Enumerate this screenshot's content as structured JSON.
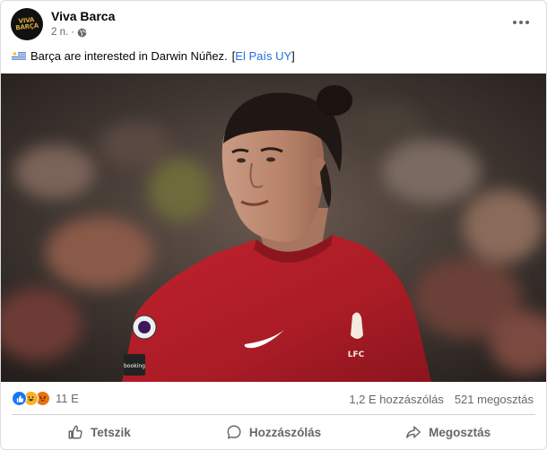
{
  "post": {
    "author": "Viva Barca",
    "avatar_text_top": "VIVA",
    "avatar_text_bottom": "BARÇA",
    "time": "2 n.",
    "text": "Barça are interested in Darwin Núñez.",
    "link_open": "[",
    "link_text": "El País UY",
    "link_close": "]",
    "flag_icon": "uruguay-flag-icon"
  },
  "image": {
    "jersey_sponsor": "LFC",
    "sleeve_text": "booking"
  },
  "stats": {
    "reactions_count": "11 E",
    "comments": "1,2 E hozzászólás",
    "shares": "521 megosztás"
  },
  "actions": {
    "like": "Tetszik",
    "comment": "Hozzászólás",
    "share": "Megosztás"
  },
  "colors": {
    "link": "#216fdb",
    "muted": "#65676b",
    "jersey": "#b8202b",
    "like_blue": "#1877f2"
  }
}
